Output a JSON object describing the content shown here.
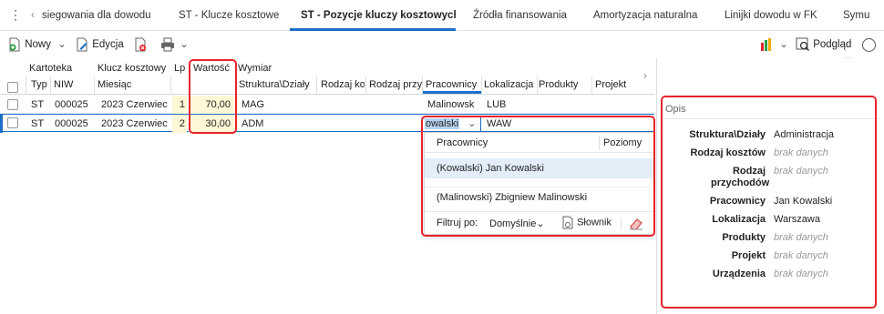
{
  "tabs": [
    {
      "label": "siegowania dla dowodu"
    },
    {
      "label": "ST - Klucze kosztowe"
    },
    {
      "label": "ST - Pozycje kluczy kosztowych"
    },
    {
      "label": "Źródła finansowania"
    },
    {
      "label": "Amortyzacja naturalna"
    },
    {
      "label": "Linijki dowodu w FK"
    },
    {
      "label": "Symu"
    }
  ],
  "toolbar": {
    "new_label": "Nowy",
    "edit_label": "Edycja",
    "preview_label": "Podgląd"
  },
  "grid": {
    "group_headers": {
      "kartoteka": "Kartoteka",
      "klucz": "Klucz kosztowy",
      "lp": "Lp",
      "wartosc": "Wartość",
      "wymiar": "Wymiar"
    },
    "columns": {
      "typ": "Typ",
      "niw": "NIW",
      "miesiac": "Miesiąc",
      "struktura": "Struktura\\Działy",
      "rodzaj_k": "Rodzaj ko",
      "rodzaj_p": "Rodzaj przy",
      "pracownicy": "Pracownicy",
      "lokalizacja": "Lokalizacja",
      "produkty": "Produkty",
      "projekt": "Projekt"
    },
    "rows": [
      {
        "typ": "ST",
        "niw": "000025",
        "miesiac": "2023 Czerwiec",
        "lp": "1",
        "wartosc": "70,00",
        "struktura": "MAG",
        "pracownicy": "Malinowsk",
        "lokalizacja": "LUB"
      },
      {
        "typ": "ST",
        "niw": "000025",
        "miesiac": "2023 Czerwiec",
        "lp": "2",
        "wartosc": "30,00",
        "struktura": "ADM",
        "pracownicy": "owalski",
        "lokalizacja": "WAW"
      }
    ]
  },
  "dropdown": {
    "col_pracownicy": "Pracownicy",
    "col_poziomy": "Poziomy",
    "items": [
      "(Kowalski) Jan Kowalski",
      "(Malinowski) Zbigniew Malinowski"
    ],
    "filter_label": "Filtruj po:",
    "filter_value": "Domyślnie",
    "slownik_label": "Słownik"
  },
  "panel": {
    "title": "Opis",
    "rows": [
      {
        "label": "Struktura\\Działy",
        "value": "Administracja",
        "nodata": false
      },
      {
        "label": "Rodzaj kosztów",
        "value": "brak danych",
        "nodata": true
      },
      {
        "label": "Rodzaj przychodów",
        "value": "brak danych",
        "nodata": true
      },
      {
        "label": "Pracownicy",
        "value": "Jan Kowalski",
        "nodata": false
      },
      {
        "label": "Lokalizacja",
        "value": "Warszawa",
        "nodata": false
      },
      {
        "label": "Produkty",
        "value": "brak danych",
        "nodata": true
      },
      {
        "label": "Projekt",
        "value": "brak danych",
        "nodata": true
      },
      {
        "label": "Urządzenia",
        "value": "brak danych",
        "nodata": true
      }
    ]
  },
  "colors": {
    "accent": "#1d6fc8",
    "highlight": "#e8232a",
    "selected_row": "#e3eef9"
  }
}
